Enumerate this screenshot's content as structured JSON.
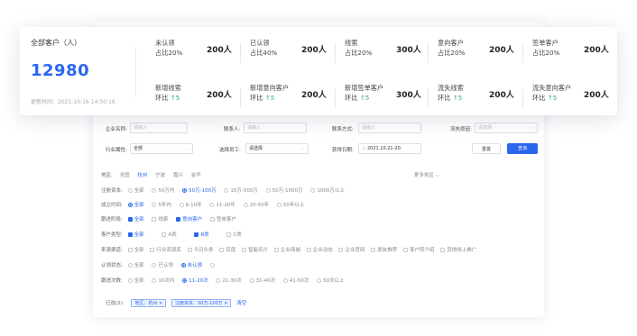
{
  "summary": {
    "title": "全部客户（人）",
    "total": "12980",
    "updated": "更新时间：2021-10-16 14:50:16"
  },
  "stats": [
    {
      "name": "未认领",
      "sub": "占比20%",
      "value": "200人"
    },
    {
      "name": "已认领",
      "sub": "占比40%",
      "value": "200人"
    },
    {
      "name": "线索",
      "sub": "占比20%",
      "value": "300人"
    },
    {
      "name": "意向客户",
      "sub": "占比20%",
      "value": "200人"
    },
    {
      "name": "签单客户",
      "sub": "占比20%",
      "value": "200人"
    },
    {
      "name": "新增线索",
      "sub": "环比",
      "trend": "↑5",
      "value": "200人"
    },
    {
      "name": "新增意向客户",
      "sub": "环比",
      "trend": "↑5",
      "value": "200人"
    },
    {
      "name": "新增签单客户",
      "sub": "环比",
      "trend": "↑5",
      "value": "300人"
    },
    {
      "name": "流失线索",
      "sub": "环比",
      "trend": "↑5",
      "value": "200人"
    },
    {
      "name": "流失意向客户",
      "sub": "环比",
      "trend": "↑5",
      "value": "200人"
    }
  ],
  "filters": {
    "company_label": "企业名称:",
    "company_placeholder": "请输入",
    "contact_label": "联系人:",
    "contact_placeholder": "请输入",
    "phone_label": "联系方式:",
    "phone_placeholder": "请输入",
    "loss_label": "流失原因:",
    "loss_placeholder": "请选择",
    "industry_label": "行业属性:",
    "industry_value": "全部",
    "staff_label": "选择员工:",
    "staff_value": "请选择",
    "date_label": "获得日期:",
    "date_value": "2021.10.21-20.",
    "reset": "重置",
    "query": "查询"
  },
  "region": {
    "label": "地区:",
    "options": [
      "全国",
      "杭州",
      "宁波",
      "嘉兴",
      "金华"
    ],
    "active": "杭州",
    "more": "更多地区 ⌵"
  },
  "capital": {
    "label": "注册资本:",
    "options": [
      "全部",
      "50万内",
      "50万-100万",
      "10万-500万",
      "50万-1000万",
      "1000万以上"
    ],
    "selected": "50万-100万"
  },
  "founded": {
    "label": "成立时间:",
    "options": [
      "全部",
      "5年内",
      "6-10年",
      "11-20年",
      "20-50年",
      "50年以上"
    ],
    "selected": "全部"
  },
  "stage": {
    "label": "跟进阶段:",
    "options": [
      "全部",
      "线索",
      "意向客户",
      "签单客户"
    ],
    "checked": [
      "全部",
      "意向客户"
    ]
  },
  "type": {
    "label": "客户类型:",
    "options": [
      "全部",
      "A类",
      "B类",
      "C类"
    ],
    "checked": [
      "全部",
      "B类"
    ]
  },
  "source": {
    "label": "来源渠道:",
    "options": [
      "全部",
      "行业资源库",
      "今日头条",
      "百度",
      "智能名片",
      "企业商城",
      "企业动态",
      "企业官网",
      "朋友推荐",
      "客户转介绍",
      "其他线上推广"
    ]
  },
  "claim": {
    "label": "认领状态:",
    "options": [
      "全部",
      "已认领",
      "未认领"
    ],
    "selected": "未认领"
  },
  "follow": {
    "label": "跟进次数:",
    "options": [
      "全部",
      "10次内",
      "11-20次",
      "21-30次",
      "31-40次",
      "41-50次",
      "50次以上"
    ],
    "selected": "11-20次"
  },
  "chosen": {
    "label": "已选(2):",
    "tags": [
      "地区：杭州",
      "注册资本：50万-100万"
    ],
    "clear": "清空"
  }
}
